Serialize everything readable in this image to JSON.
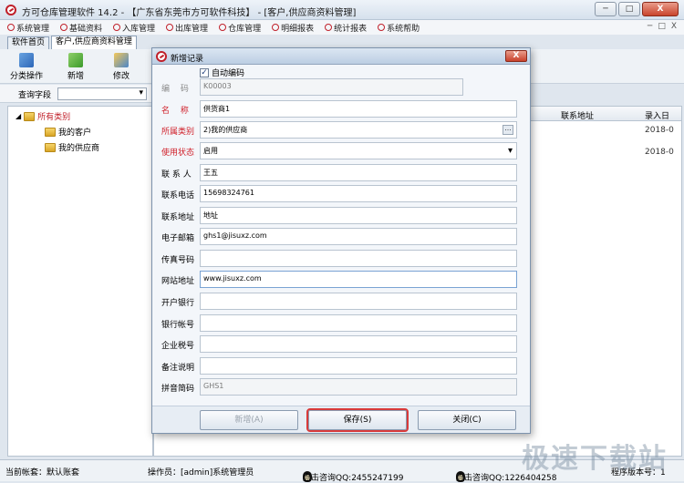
{
  "window": {
    "title": "方可仓库管理软件 14.2 - 【广东省东莞市方可软件科技】 - [客户,供应商资料管理]",
    "min_label": "─",
    "max_label": "□",
    "close_label": "X"
  },
  "menubar": {
    "items": [
      "系统管理",
      "基础资料",
      "入库管理",
      "出库管理",
      "仓库管理",
      "明细报表",
      "统计报表",
      "系统帮助"
    ],
    "right_controls": [
      "─",
      "□",
      "X"
    ]
  },
  "tabs": [
    "软件首页",
    "客户,供应商资料管理"
  ],
  "toolbar": {
    "buttons": [
      "分类操作",
      "新增",
      "修改"
    ]
  },
  "filter": {
    "label": "查询字段",
    "value": ""
  },
  "tree": {
    "root": "所有类别",
    "children": [
      "我的客户",
      "我的供应商"
    ]
  },
  "grid": {
    "headers": [
      "联系地址",
      "录入日"
    ],
    "rows": [
      [
        "",
        "2018-0"
      ],
      [
        "",
        "2018-0"
      ]
    ]
  },
  "status": {
    "account": "当前帐套：默认账套",
    "operator": "操作员：[admin]系统管理员",
    "qq1": "点击咨询QQ:2455247199",
    "qq2": "点击咨询QQ:1226404258",
    "version": "程序版本号：1"
  },
  "watermark": "极速下载站",
  "modal": {
    "title": "新增记录",
    "close_label": "X",
    "auto_code_label": "自动编码",
    "auto_code_checked": "✓",
    "fields": [
      {
        "label": "编 　码",
        "value": "K00003"
      },
      {
        "label": "名 　称",
        "value": "供货商1"
      },
      {
        "label": "所属类别",
        "value": "2)我的供应商"
      },
      {
        "label": "使用状态",
        "value": "启用"
      },
      {
        "label": "联 系 人",
        "value": "王五"
      },
      {
        "label": "联系电话",
        "value": "15698324761"
      },
      {
        "label": "联系地址",
        "value": "地址"
      },
      {
        "label": "电子邮箱",
        "value": "ghs1@jisuxz.com"
      },
      {
        "label": "传真号码",
        "value": ""
      },
      {
        "label": "网站地址",
        "value": "www.jisuxz.com"
      },
      {
        "label": "开户银行",
        "value": ""
      },
      {
        "label": "银行帐号",
        "value": ""
      },
      {
        "label": "企业税号",
        "value": ""
      },
      {
        "label": "备注说明",
        "value": ""
      },
      {
        "label": "拼音简码",
        "value": "GHS1"
      }
    ],
    "buttons": {
      "add": "新增(A)",
      "save": "保存(S)",
      "close": "关闭(C)"
    }
  }
}
